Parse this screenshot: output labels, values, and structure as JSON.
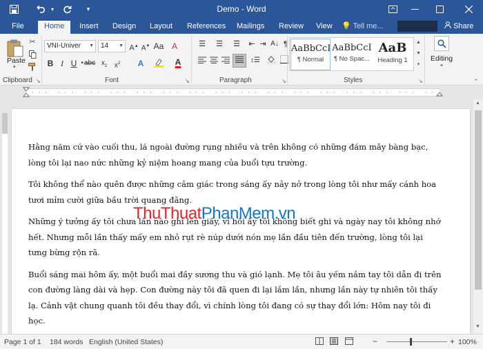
{
  "titlebar": {
    "title": "Demo - Word",
    "save_icon": "save-icon",
    "undo_icon": "undo-icon",
    "redo_icon": "redo-icon",
    "customize_icon": "customize-qat-icon",
    "ribbon_display_icon": "ribbon-display-icon",
    "minimize_icon": "minimize-icon",
    "maximize_icon": "maximize-icon",
    "close_icon": "close-icon"
  },
  "tabs": [
    {
      "label": "File"
    },
    {
      "label": "Home"
    },
    {
      "label": "Insert"
    },
    {
      "label": "Design"
    },
    {
      "label": "Layout"
    },
    {
      "label": "References"
    },
    {
      "label": "Mailings"
    },
    {
      "label": "Review"
    },
    {
      "label": "View"
    }
  ],
  "tell_me": "Tell me...",
  "share": "Share",
  "ribbon": {
    "clipboard": {
      "label": "Clipboard",
      "paste": "Paste"
    },
    "font": {
      "label": "Font",
      "font_name": "VNI-Univer",
      "font_size": "14"
    },
    "paragraph": {
      "label": "Paragraph"
    },
    "styles": {
      "label": "Styles",
      "items": [
        {
          "preview": "AaBbCcI",
          "name": "¶ Normal"
        },
        {
          "preview": "AaBbCcI",
          "name": "¶ No Spac..."
        },
        {
          "preview": "AaB",
          "name": "Heading 1"
        }
      ]
    },
    "editing": {
      "label": "Editing"
    }
  },
  "document": {
    "paragraphs": [
      "Hằng năm cứ vào cuối thu, lá ngoài đường rụng nhiều và trên không có những đám mây bàng bạc, lòng tôi lại nao nức những kỷ niệm hoang mang của buổi tựu trường.",
      "Tôi không thể nào quên được những cảm giác trong sáng ấy nảy nở trong lòng tôi như mấy cánh hoa tươi mỉm cười giữa bầu trời quang đãng.",
      "Những ý tưởng ấy tôi chưa lần nào ghi lên giấy, vì hồi ấy tôi không biết ghi và ngày nay tôi không nhớ hết. Nhưng mỗi lần thấy mấy em nhỏ rụt rè núp dưới nón mẹ lần đầu tiên đến trường, lòng tôi lại tưng bừng rộn rã.",
      "Buổi sáng mai hôm ấy, một buổi mai đầy sương thu và gió lạnh. Mẹ tôi âu yếm nắm tay tôi dẫn đi trên con đường làng dài và hẹp. Con đường này tôi đã quen đi lại lắm lần, nhưng lần này tự nhiên tôi thấy lạ. Cảnh vật chung quanh tôi đều thay đổi, vì chính lòng tôi đang có sự thay đổi lớn: Hôm nay tôi đi học."
    ],
    "watermark_part1": "ThuThuat",
    "watermark_part2": "PhanMem.vn"
  },
  "status": {
    "page": "Page 1 of 1",
    "words": "184 words",
    "language": "English (United States)",
    "zoom": "100%",
    "zoom_minus": "−",
    "zoom_plus": "+"
  },
  "colors": {
    "accent": "#2b579a",
    "watermark_red": "#e8232a",
    "watermark_blue": "#1677c9"
  }
}
